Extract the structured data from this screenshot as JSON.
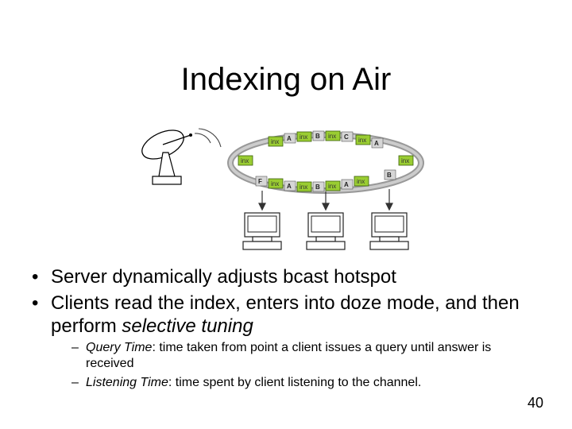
{
  "title": "Indexing on Air",
  "inx_label": "inx",
  "data_labels": [
    "A",
    "B",
    "C",
    "A",
    "A",
    "B",
    "A",
    "F"
  ],
  "bullets": {
    "b1": "Server dynamically adjusts bcast hotspot",
    "b2_pre": "Clients read the index, enters into doze mode, and then perform ",
    "b2_em": "selective tuning"
  },
  "sub_bullets": {
    "s1_em": "Query Time",
    "s1_rest": ": time taken from point a client issues a query until answer is received",
    "s2_em": "Listening Time",
    "s2_rest": ": time spent by client listening to the channel."
  },
  "slide_number": "40"
}
